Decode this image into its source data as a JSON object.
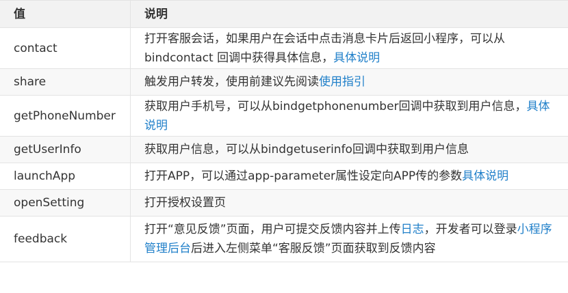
{
  "header": {
    "col_value": "值",
    "col_desc": "说明"
  },
  "rows": [
    {
      "value": "contact",
      "desc_pre": "打开客服会话，如果用户在会话中点击消息卡片后返回小程序，可以从bindcontact 回调中获得具体信息，",
      "link": "具体说明",
      "desc_mid": "",
      "link2": "",
      "desc_post": ""
    },
    {
      "value": "share",
      "desc_pre": "触发用户转发，使用前建议先阅读",
      "link": "使用指引",
      "desc_mid": "",
      "link2": "",
      "desc_post": ""
    },
    {
      "value": "getPhoneNumber",
      "desc_pre": "获取用户手机号，可以从bindgetphonenumber回调中获取到用户信息，",
      "link": "具体说明",
      "desc_mid": "",
      "link2": "",
      "desc_post": ""
    },
    {
      "value": "getUserInfo",
      "desc_pre": "获取用户信息，可以从bindgetuserinfo回调中获取到用户信息",
      "link": "",
      "desc_mid": "",
      "link2": "",
      "desc_post": ""
    },
    {
      "value": "launchApp",
      "desc_pre": "打开APP，可以通过app-parameter属性设定向APP传的参数",
      "link": "具体说明",
      "desc_mid": "",
      "link2": "",
      "desc_post": ""
    },
    {
      "value": "openSetting",
      "desc_pre": "打开授权设置页",
      "link": "",
      "desc_mid": "",
      "link2": "",
      "desc_post": ""
    },
    {
      "value": "feedback",
      "desc_pre": "打开“意见反馈”页面，用户可提交反馈内容并上传",
      "link": "日志",
      "desc_mid": "，开发者可以登录",
      "link2": "小程序管理后台",
      "desc_post": "后进入左侧菜单“客服反馈”页面获取到反馈内容"
    }
  ]
}
